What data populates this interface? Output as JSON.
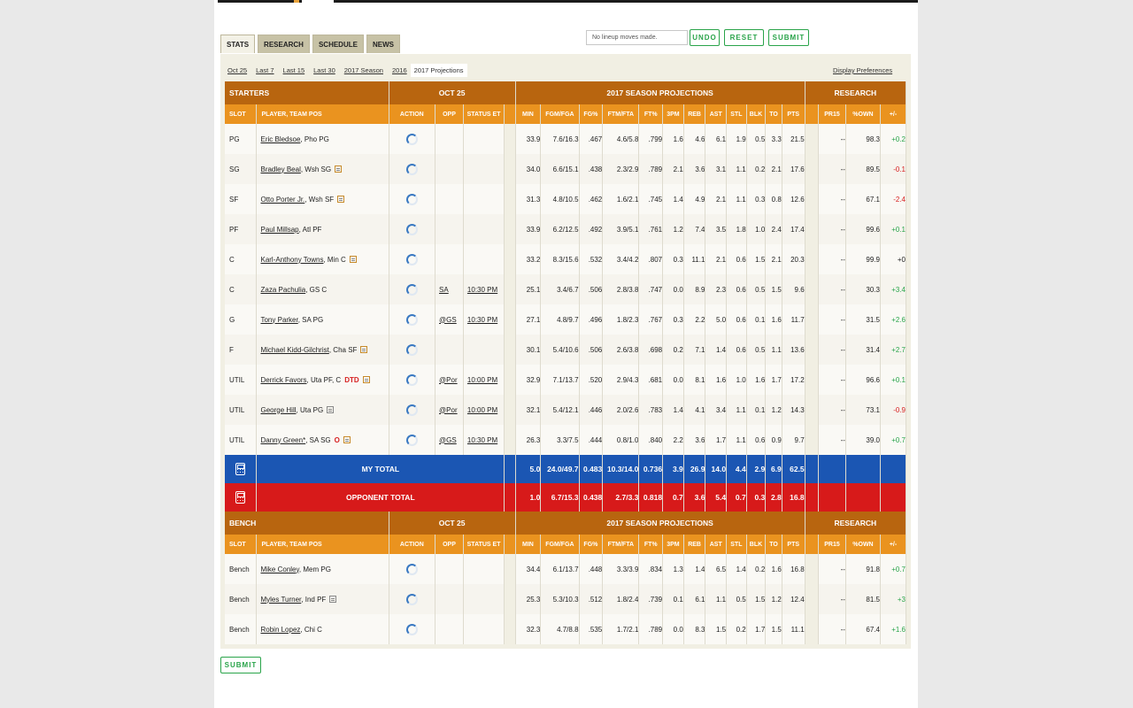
{
  "tabs": [
    "STATS",
    "RESEARCH",
    "SCHEDULE",
    "NEWS"
  ],
  "lineup_status": "No lineup moves made.",
  "buttons": {
    "undo": "UNDO",
    "reset": "RESET",
    "submit": "SUBMIT"
  },
  "subtabs": [
    "Oct 25",
    "Last 7",
    "Last 15",
    "Last 30",
    "2017 Season",
    "2016",
    "2017 Projections"
  ],
  "display_preferences": "Display Preferences",
  "starters_header": {
    "section": "STARTERS",
    "date": "OCT 25",
    "proj": "2017 SEASON PROJECTIONS",
    "research": "RESEARCH"
  },
  "bench_header": {
    "section": "BENCH",
    "date": "OCT 25",
    "proj": "2017 SEASON PROJECTIONS",
    "research": "RESEARCH"
  },
  "columns": [
    "SLOT",
    "PLAYER, TEAM POS",
    "ACTION",
    "OPP",
    "STATUS ET",
    "MIN",
    "FGM/FGA",
    "FG%",
    "FTM/FTA",
    "FT%",
    "3PM",
    "REB",
    "AST",
    "STL",
    "BLK",
    "TO",
    "PTS",
    "PR15",
    "%OWN",
    "+/-"
  ],
  "starters": [
    {
      "slot": "PG",
      "name": "Eric Bledsoe",
      "team": ", Pho PG",
      "note": false,
      "badge": "",
      "opp": "",
      "status": "",
      "min": "33.9",
      "fg": "7.6/16.3",
      "fgp": ".467",
      "ft": "4.6/5.8",
      "ftp": ".799",
      "tpm": "1.6",
      "reb": "4.6",
      "ast": "6.1",
      "stl": "1.9",
      "blk": "0.5",
      "to": "3.3",
      "pts": "21.5",
      "pr15": "--",
      "own": "98.3",
      "pm": "+0.2"
    },
    {
      "slot": "SG",
      "name": "Bradley Beal",
      "team": ", Wsh SG",
      "note": true,
      "badge": "",
      "opp": "",
      "status": "",
      "min": "34.0",
      "fg": "6.6/15.1",
      "fgp": ".438",
      "ft": "2.3/2.9",
      "ftp": ".789",
      "tpm": "2.1",
      "reb": "3.6",
      "ast": "3.1",
      "stl": "1.1",
      "blk": "0.2",
      "to": "2.1",
      "pts": "17.6",
      "pr15": "--",
      "own": "89.5",
      "pm": "-0.1"
    },
    {
      "slot": "SF",
      "name": "Otto Porter Jr.",
      "team": ", Wsh SF",
      "note": true,
      "badge": "",
      "opp": "",
      "status": "",
      "min": "31.3",
      "fg": "4.8/10.5",
      "fgp": ".462",
      "ft": "1.6/2.1",
      "ftp": ".745",
      "tpm": "1.4",
      "reb": "4.9",
      "ast": "2.1",
      "stl": "1.1",
      "blk": "0.3",
      "to": "0.8",
      "pts": "12.6",
      "pr15": "--",
      "own": "67.1",
      "pm": "-2.4"
    },
    {
      "slot": "PF",
      "name": "Paul Millsap",
      "team": ", Atl PF",
      "note": false,
      "badge": "",
      "opp": "",
      "status": "",
      "min": "33.9",
      "fg": "6.2/12.5",
      "fgp": ".492",
      "ft": "3.9/5.1",
      "ftp": ".761",
      "tpm": "1.2",
      "reb": "7.4",
      "ast": "3.5",
      "stl": "1.8",
      "blk": "1.0",
      "to": "2.4",
      "pts": "17.4",
      "pr15": "--",
      "own": "99.6",
      "pm": "+0.1"
    },
    {
      "slot": "C",
      "name": "Karl-Anthony Towns",
      "team": ", Min C",
      "note": true,
      "badge": "",
      "opp": "",
      "status": "",
      "min": "33.2",
      "fg": "8.3/15.6",
      "fgp": ".532",
      "ft": "3.4/4.2",
      "ftp": ".807",
      "tpm": "0.3",
      "reb": "11.1",
      "ast": "2.1",
      "stl": "0.6",
      "blk": "1.5",
      "to": "2.1",
      "pts": "20.3",
      "pr15": "--",
      "own": "99.9",
      "pm": "+0"
    },
    {
      "slot": "C",
      "name": "Zaza Pachulia",
      "team": ", GS C",
      "note": false,
      "badge": "",
      "opp": "SA",
      "status": "10:30 PM",
      "min": "25.1",
      "fg": "3.4/6.7",
      "fgp": ".506",
      "ft": "2.8/3.8",
      "ftp": ".747",
      "tpm": "0.0",
      "reb": "8.9",
      "ast": "2.3",
      "stl": "0.6",
      "blk": "0.5",
      "to": "1.5",
      "pts": "9.6",
      "pr15": "--",
      "own": "30.3",
      "pm": "+3.4"
    },
    {
      "slot": "G",
      "name": "Tony Parker",
      "team": ", SA PG",
      "note": false,
      "badge": "",
      "opp": "@GS",
      "status": "10:30 PM",
      "min": "27.1",
      "fg": "4.8/9.7",
      "fgp": ".496",
      "ft": "1.8/2.3",
      "ftp": ".767",
      "tpm": "0.3",
      "reb": "2.2",
      "ast": "5.0",
      "stl": "0.6",
      "blk": "0.1",
      "to": "1.6",
      "pts": "11.7",
      "pr15": "--",
      "own": "31.5",
      "pm": "+2.6"
    },
    {
      "slot": "F",
      "name": "Michael Kidd-Gilchrist",
      "team": ", Cha SF",
      "note": true,
      "badge": "",
      "opp": "",
      "status": "",
      "min": "30.1",
      "fg": "5.4/10.6",
      "fgp": ".506",
      "ft": "2.6/3.8",
      "ftp": ".698",
      "tpm": "0.2",
      "reb": "7.1",
      "ast": "1.4",
      "stl": "0.6",
      "blk": "0.5",
      "to": "1.1",
      "pts": "13.6",
      "pr15": "--",
      "own": "31.4",
      "pm": "+2.7"
    },
    {
      "slot": "UTIL",
      "name": "Derrick Favors",
      "team": ", Uta PF, C",
      "note": true,
      "badge": "DTD",
      "opp": "@Por",
      "status": "10:00 PM",
      "min": "32.9",
      "fg": "7.1/13.7",
      "fgp": ".520",
      "ft": "2.9/4.3",
      "ftp": ".681",
      "tpm": "0.0",
      "reb": "8.1",
      "ast": "1.6",
      "stl": "1.0",
      "blk": "1.6",
      "to": "1.7",
      "pts": "17.2",
      "pr15": "--",
      "own": "96.6",
      "pm": "+0.1"
    },
    {
      "slot": "UTIL",
      "name": "George Hill",
      "team": ", Uta PG",
      "note": true,
      "badge": "",
      "opp": "@Por",
      "status": "10:00 PM",
      "min": "32.1",
      "fg": "5.4/12.1",
      "fgp": ".446",
      "ft": "2.0/2.6",
      "ftp": ".783",
      "tpm": "1.4",
      "reb": "4.1",
      "ast": "3.4",
      "stl": "1.1",
      "blk": "0.1",
      "to": "1.2",
      "pts": "14.3",
      "pr15": "--",
      "own": "73.1",
      "pm": "-0.9"
    },
    {
      "slot": "UTIL",
      "name": "Danny Green*",
      "team": ", SA SG",
      "note": true,
      "badge": "O",
      "opp": "@GS",
      "status": "10:30 PM",
      "min": "26.3",
      "fg": "3.3/7.5",
      "fgp": ".444",
      "ft": "0.8/1.0",
      "ftp": ".840",
      "tpm": "2.2",
      "reb": "3.6",
      "ast": "1.7",
      "stl": "1.1",
      "blk": "0.6",
      "to": "0.9",
      "pts": "9.7",
      "pr15": "--",
      "own": "39.0",
      "pm": "+0.7"
    }
  ],
  "my_total": {
    "label": "MY TOTAL",
    "min": "5.0",
    "fg": "24.0/49.7",
    "fgp": "0.483",
    "ft": "10.3/14.0",
    "ftp": "0.736",
    "tpm": "3.9",
    "reb": "26.9",
    "ast": "14.0",
    "stl": "4.4",
    "blk": "2.9",
    "to": "6.9",
    "pts": "62.5"
  },
  "opp_total": {
    "label": "OPPONENT TOTAL",
    "min": "1.0",
    "fg": "6.7/15.3",
    "fgp": "0.438",
    "ft": "2.7/3.3",
    "ftp": "0.818",
    "tpm": "0.7",
    "reb": "3.6",
    "ast": "5.4",
    "stl": "0.7",
    "blk": "0.3",
    "to": "2.8",
    "pts": "16.8"
  },
  "bench": [
    {
      "slot": "Bench",
      "name": "Mike Conley",
      "team": ", Mem PG",
      "note": false,
      "badge": "",
      "opp": "",
      "status": "",
      "min": "34.4",
      "fg": "6.1/13.7",
      "fgp": ".448",
      "ft": "3.3/3.9",
      "ftp": ".834",
      "tpm": "1.3",
      "reb": "1.4",
      "ast": "6.5",
      "stl": "1.4",
      "blk": "0.2",
      "to": "1.6",
      "pts": "16.8",
      "pr15": "--",
      "own": "91.8",
      "pm": "+0.7"
    },
    {
      "slot": "Bench",
      "name": "Myles Turner",
      "team": ", Ind PF",
      "note": true,
      "badge": "",
      "opp": "",
      "status": "",
      "min": "25.3",
      "fg": "5.3/10.3",
      "fgp": ".512",
      "ft": "1.8/2.4",
      "ftp": ".739",
      "tpm": "0.1",
      "reb": "6.1",
      "ast": "1.1",
      "stl": "0.5",
      "blk": "1.5",
      "to": "1.2",
      "pts": "12.4",
      "pr15": "--",
      "own": "81.5",
      "pm": "+3"
    },
    {
      "slot": "Bench",
      "name": "Robin Lopez",
      "team": ", Chi C",
      "note": false,
      "badge": "",
      "opp": "",
      "status": "",
      "min": "32.3",
      "fg": "4.7/8.8",
      "fgp": ".535",
      "ft": "1.7/2.1",
      "ftp": ".789",
      "tpm": "0.0",
      "reb": "8.3",
      "ast": "1.5",
      "stl": "0.2",
      "blk": "1.7",
      "to": "1.5",
      "pts": "11.1",
      "pr15": "--",
      "own": "67.4",
      "pm": "+1.6"
    }
  ],
  "bottom_submit": "SUBMIT"
}
